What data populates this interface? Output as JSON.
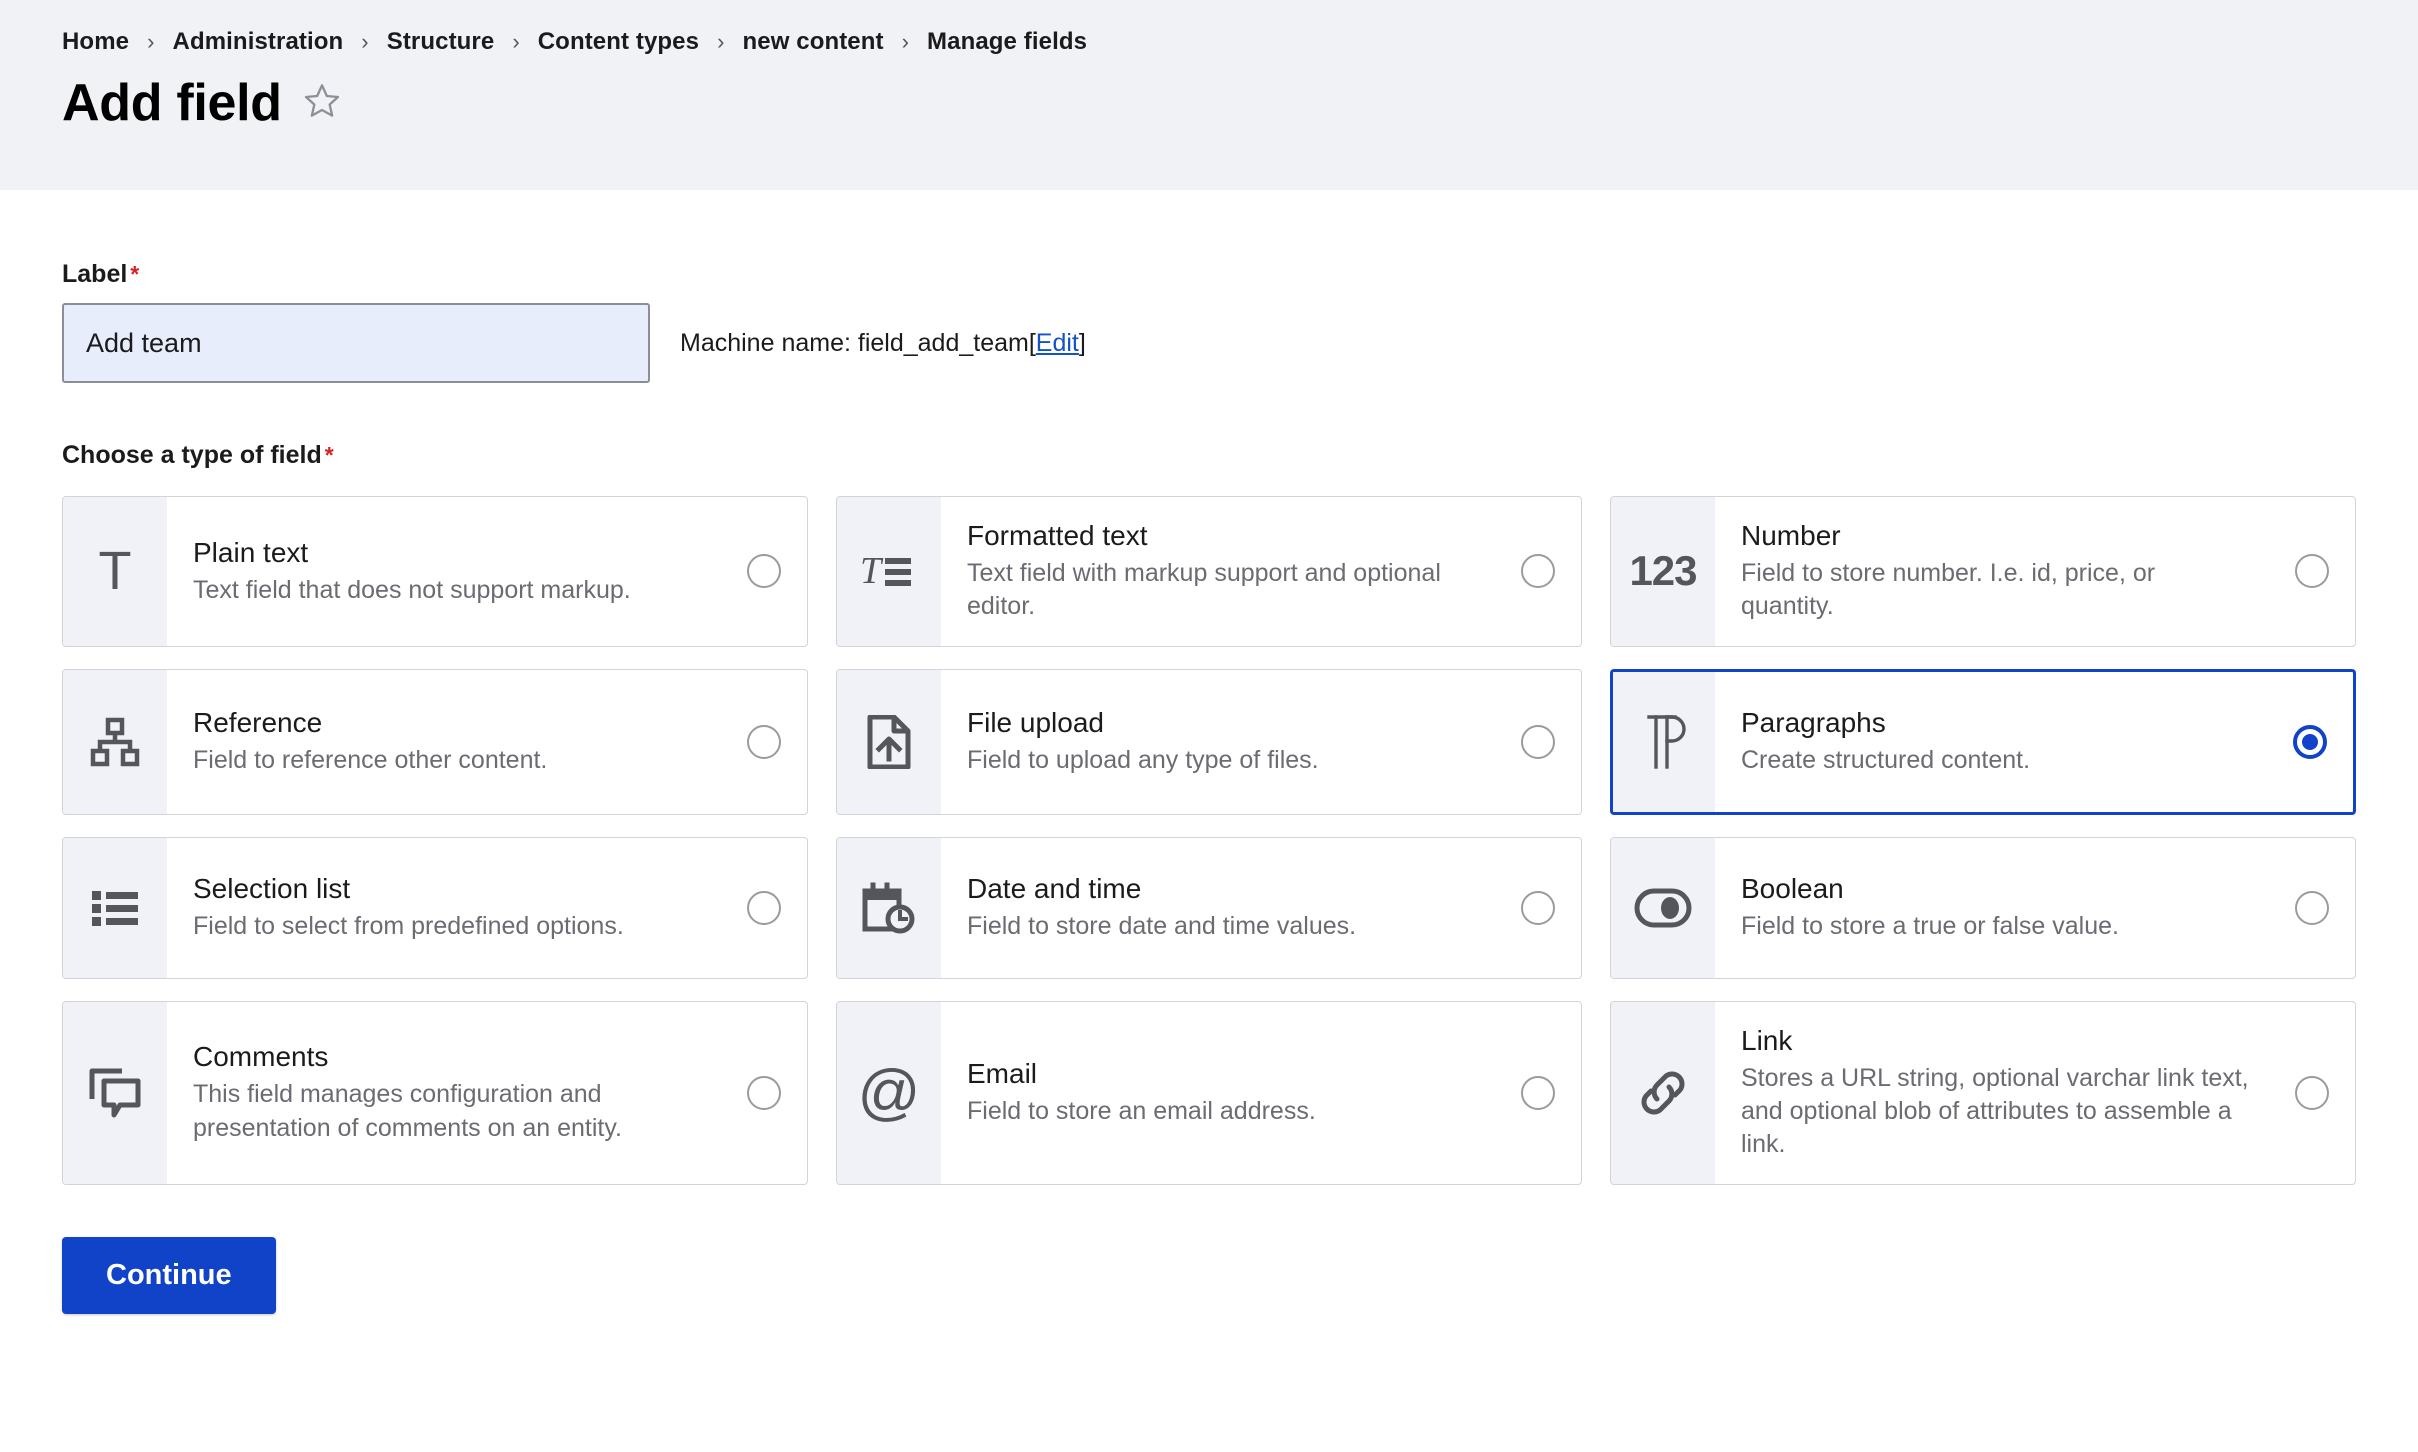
{
  "breadcrumb": {
    "separator": "›",
    "items": [
      {
        "label": "Home"
      },
      {
        "label": "Administration"
      },
      {
        "label": "Structure"
      },
      {
        "label": "Content types"
      },
      {
        "label": "new content"
      },
      {
        "label": "Manage fields"
      }
    ]
  },
  "header": {
    "title": "Add field",
    "star_icon": "star-outline-icon"
  },
  "form": {
    "label_field": {
      "label": "Label",
      "required_mark": "*",
      "value": "Add team",
      "placeholder": ""
    },
    "machine_name": {
      "prefix": "Machine name: ",
      "value": "field_add_team",
      "bracket_open": "[",
      "edit_label": "Edit",
      "bracket_close": "]"
    },
    "choose_type": {
      "label": "Choose a type of field",
      "required_mark": "*"
    },
    "selected_type": "Paragraphs"
  },
  "field_types": [
    {
      "title": "Plain text",
      "description": "Text field that does not support markup.",
      "icon": "letter-t-icon",
      "selected": false
    },
    {
      "title": "Formatted text",
      "description": "Text field with markup support and optional editor.",
      "icon": "formatted-text-icon",
      "selected": false
    },
    {
      "title": "Number",
      "description": "Field to store number. I.e. id, price, or quantity.",
      "icon": "number-123-icon",
      "selected": false
    },
    {
      "title": "Reference",
      "description": "Field to reference other content.",
      "icon": "hierarchy-icon",
      "selected": false
    },
    {
      "title": "File upload",
      "description": "Field to upload any type of files.",
      "icon": "file-upload-icon",
      "selected": false
    },
    {
      "title": "Paragraphs",
      "description": "Create structured content.",
      "icon": "paragraphs-pilcrow-icon",
      "selected": true
    },
    {
      "title": "Selection list",
      "description": "Field to select from predefined options.",
      "icon": "bulleted-list-icon",
      "selected": false
    },
    {
      "title": "Date and time",
      "description": "Field to store date and time values.",
      "icon": "calendar-clock-icon",
      "selected": false
    },
    {
      "title": "Boolean",
      "description": "Field to store a true or false value.",
      "icon": "toggle-switch-icon",
      "selected": false
    },
    {
      "title": "Comments",
      "description": "This field manages configuration and presentation of comments on an entity.",
      "icon": "comment-bubbles-icon",
      "selected": false
    },
    {
      "title": "Email",
      "description": "Field to store an email address.",
      "icon": "at-sign-icon",
      "selected": false
    },
    {
      "title": "Link",
      "description": "Stores a URL string, optional varchar link text, and optional blob of attributes to assemble a link.",
      "icon": "chain-link-icon",
      "selected": false
    }
  ],
  "actions": {
    "continue_label": "Continue"
  },
  "colors": {
    "accent": "#1043c8",
    "header_band": "#f0f2f6",
    "required": "#d72222",
    "icon_tile": "#f0f2f7",
    "input_fill": "#e7edfa",
    "muted_text": "#6b6c72"
  }
}
